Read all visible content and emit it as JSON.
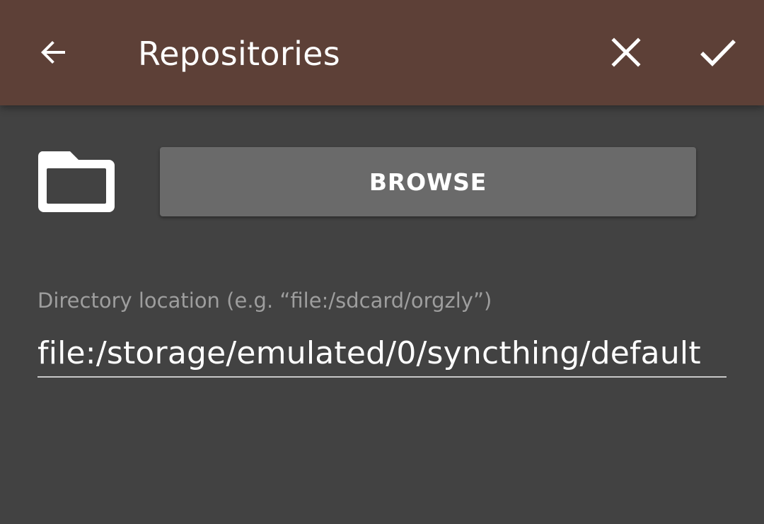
{
  "toolbar": {
    "back_icon": "arrow-back-icon",
    "title": "Repositories",
    "close_icon": "close-icon",
    "done_icon": "check-icon",
    "background_color": "#5d4037"
  },
  "content": {
    "folder_icon": "folder-icon",
    "browse_label": "BROWSE",
    "directory_label": "Directory location (e.g. “file:/sdcard/orgzly”)",
    "directory_value": "file:/storage/emulated/0/syncthing/default",
    "background_color": "#424242"
  }
}
